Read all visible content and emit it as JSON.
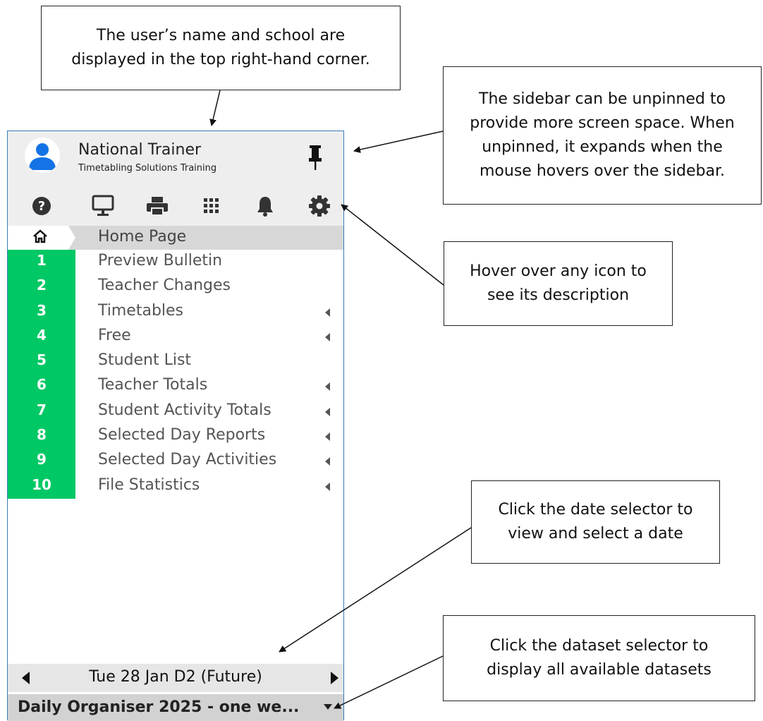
{
  "callouts": {
    "user_info": "The user’s name and school are\ndisplayed in the top right-hand corner.",
    "pin": "The sidebar can be unpinned to\nprovide more screen space. When\nunpinned, it expands when the\nmouse hovers over the sidebar.",
    "icons": "Hover over any icon to\nsee its description",
    "date_selector": "Click the date selector to\nview and select a date",
    "dataset_selector": "Click the dataset selector to\ndisplay all available datasets"
  },
  "sidebar": {
    "user_name": "National Trainer",
    "school_name": "Timetabling Solutions Training",
    "toolbar_icons": [
      "help-icon",
      "monitor-icon",
      "print-icon",
      "apps-grid-icon",
      "bell-icon",
      "gear-icon"
    ],
    "home_label": "Home Page",
    "menu": [
      {
        "num": "1",
        "label": "Preview Bulletin",
        "submenu": false
      },
      {
        "num": "2",
        "label": "Teacher Changes",
        "submenu": false
      },
      {
        "num": "3",
        "label": "Timetables",
        "submenu": true
      },
      {
        "num": "4",
        "label": "Free",
        "submenu": true
      },
      {
        "num": "5",
        "label": "Student List",
        "submenu": false
      },
      {
        "num": "6",
        "label": "Teacher Totals",
        "submenu": true
      },
      {
        "num": "7",
        "label": "Student Activity Totals",
        "submenu": true
      },
      {
        "num": "8",
        "label": "Selected Day Reports",
        "submenu": true
      },
      {
        "num": "9",
        "label": "Selected Day Activities",
        "submenu": true
      },
      {
        "num": "10",
        "label": "File Statistics",
        "submenu": true
      }
    ],
    "date": "Tue 28 Jan D2 (Future)",
    "dataset": "Daily Organiser 2025 - one we..."
  },
  "colors": {
    "accent_green": "#00c865",
    "avatar_blue": "#1473e6",
    "sidebar_border": "#3a7bbf"
  }
}
